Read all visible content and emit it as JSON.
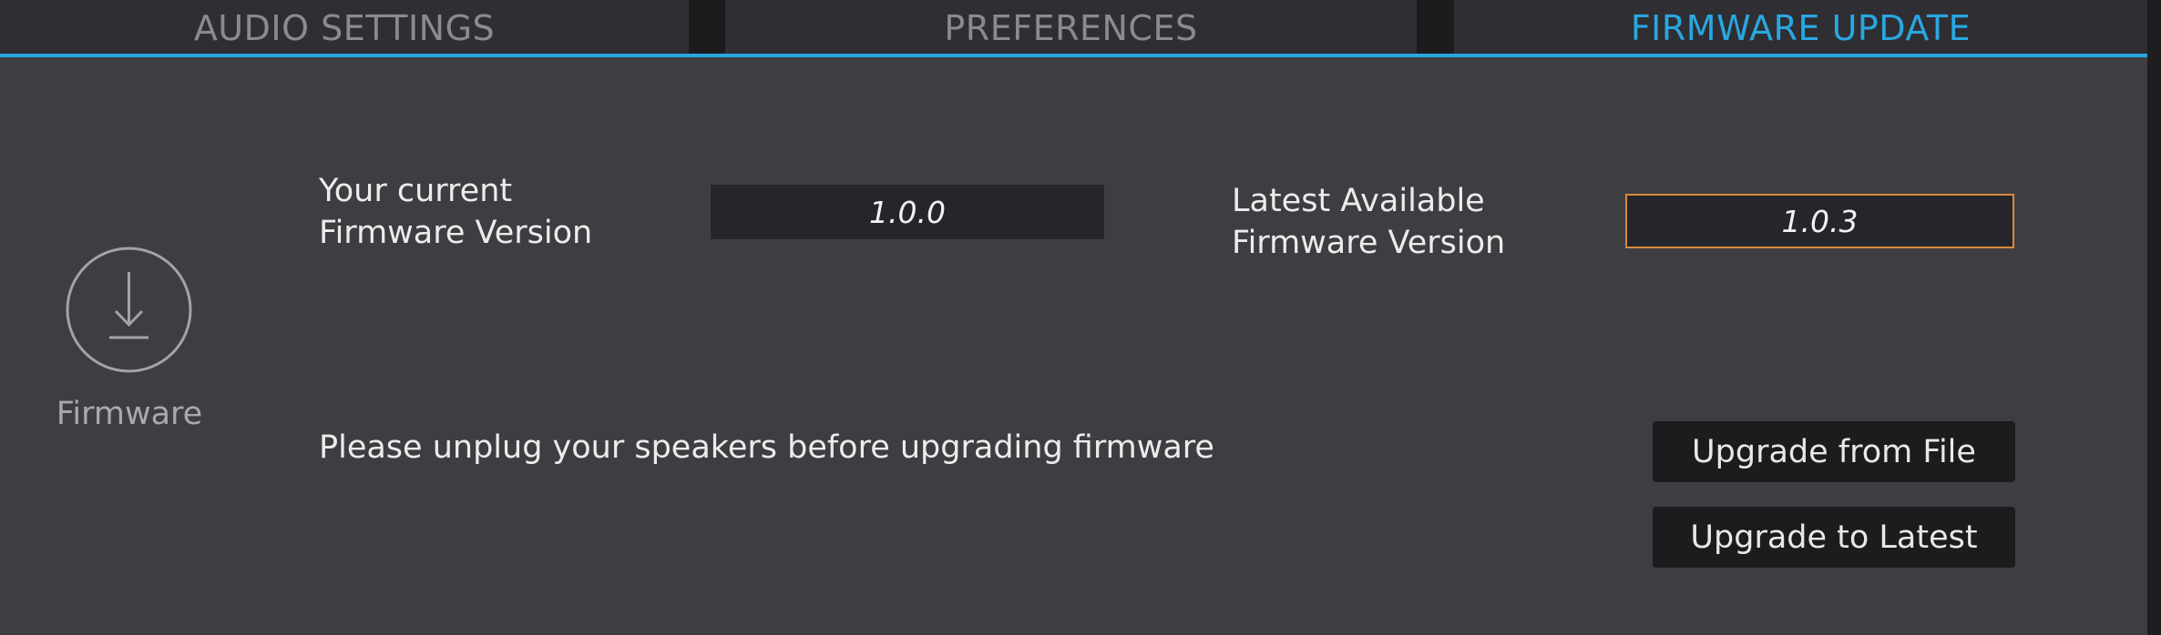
{
  "tabs": [
    {
      "label": "AUDIO SETTINGS",
      "active": false
    },
    {
      "label": "PREFERENCES",
      "active": false
    },
    {
      "label": "FIRMWARE UPDATE",
      "active": true
    }
  ],
  "colors": {
    "accent": "#29a7e1",
    "panel_bg": "#3e3e42",
    "highlight_border": "#d98a3a"
  },
  "firmware": {
    "icon": "download-icon",
    "section_label": "Firmware",
    "current_label_line1": "Your current",
    "current_label_line2": "Firmware Version",
    "current_version": "1.0.0",
    "latest_label_line1": "Latest Available",
    "latest_label_line2": "Firmware Version",
    "latest_version": "1.0.3",
    "warning": "Please unplug your speakers before upgrading firmware",
    "upgrade_file_label": "Upgrade from File",
    "upgrade_latest_label": "Upgrade to Latest"
  }
}
